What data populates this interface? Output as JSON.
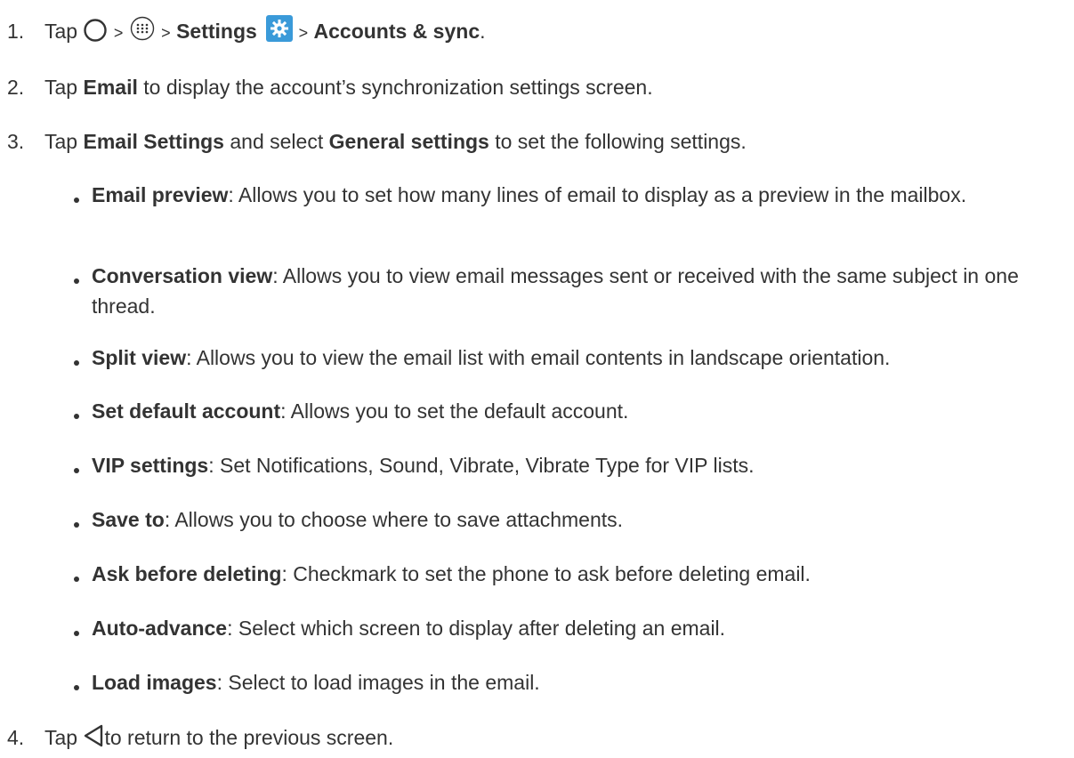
{
  "steps": [
    {
      "num": "1.",
      "parts": {
        "tap": "Tap",
        "gt1": ">",
        "gt2": ">",
        "settings": "Settings",
        "gt3": ">",
        "accounts": "Accounts & sync",
        "end": "."
      },
      "icons": [
        "home-circle-icon",
        "apps-icon",
        "settings-gear-icon"
      ]
    },
    {
      "num": "2.",
      "parts": {
        "tap": "Tap",
        "bold": "Email",
        "rest": "to display the account’s synchronization settings screen."
      }
    },
    {
      "num": "3.",
      "parts": {
        "tap": "Tap",
        "bold1": "Email Settings",
        "mid": "and select",
        "bold2": "General settings",
        "rest": "to set the following settings."
      }
    },
    {
      "num": "4.",
      "parts": {
        "tap": "Tap",
        "rest": "to return to the previous screen."
      },
      "icons": [
        "back-triangle-icon"
      ]
    }
  ],
  "bullets": [
    {
      "term": "Email preview",
      "desc": ": Allows you to set how many lines of email to display as a preview in the mailbox."
    },
    {
      "term": "Conversation view",
      "desc": ": Allows you to view email messages sent or received with the same subject in one thread."
    },
    {
      "term": "Split view",
      "desc": ": Allows you to view the email list with email contents in landscape orientation."
    },
    {
      "term": "Set default account",
      "desc": ": Allows you to set the default account."
    },
    {
      "term": "VIP settings",
      "desc": ": Set Notifications, Sound, Vibrate, Vibrate Type for VIP lists."
    },
    {
      "term": "Save to",
      "desc": ": Allows you to choose where to save attachments."
    },
    {
      "term": "Ask before deleting",
      "desc": ": Checkmark to set the phone to ask before deleting email."
    },
    {
      "term": "Auto-advance",
      "desc": ": Select which screen to display after deleting an email."
    },
    {
      "term": "Load images",
      "desc": ": Select to load images in the email."
    }
  ],
  "colors": {
    "text": "#333333",
    "settings_icon_bg": "#3a9ad9"
  }
}
